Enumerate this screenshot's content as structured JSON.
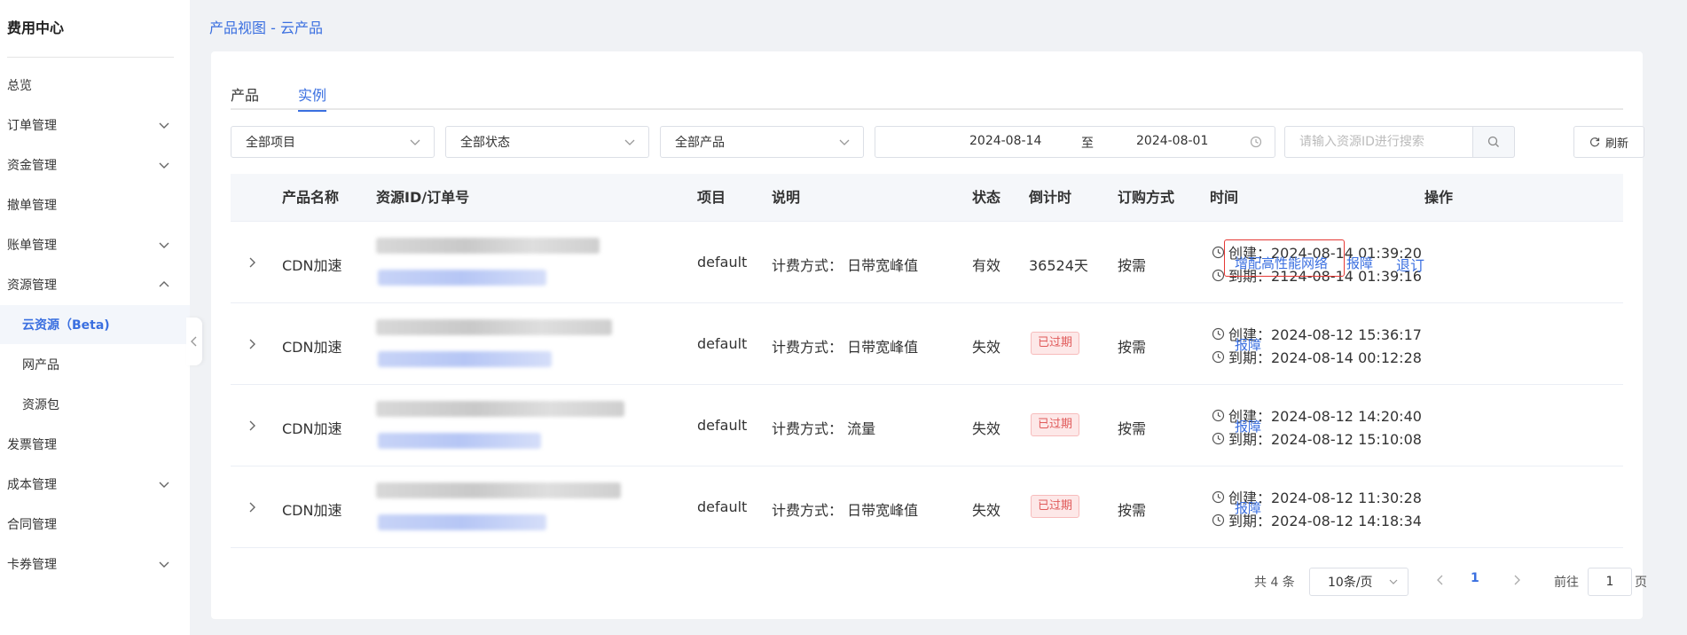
{
  "sidebar": {
    "title": "费用中心",
    "items": [
      {
        "label": "总览"
      },
      {
        "label": "订单管理"
      },
      {
        "label": "资金管理"
      },
      {
        "label": "撤单管理"
      },
      {
        "label": "账单管理"
      },
      {
        "label": "资源管理"
      },
      {
        "label": "云资源（Beta)"
      },
      {
        "label": "网产品"
      },
      {
        "label": "资源包"
      },
      {
        "label": "发票管理"
      },
      {
        "label": "成本管理"
      },
      {
        "label": "合同管理"
      },
      {
        "label": "卡券管理"
      }
    ]
  },
  "breadcrumb": "产品视图 - 云产品",
  "tabs": [
    {
      "label": "产品"
    },
    {
      "label": "实例"
    }
  ],
  "filters": {
    "project": "全部项目",
    "status": "全部状态",
    "product": "全部产品",
    "date_start": "2024-08-14",
    "date_sep": "至",
    "date_end": "2024-08-01",
    "search_placeholder": "请输入资源ID进行搜索",
    "refresh_label": "刷新"
  },
  "table": {
    "headers": {
      "product": "产品名称",
      "resource": "资源ID/订单号",
      "project": "项目",
      "desc": "说明",
      "status": "状态",
      "countdown": "倒计时",
      "billing": "订购方式",
      "time": "时间",
      "actions": "操作"
    },
    "rows": [
      {
        "product": "CDN加速",
        "project": "default",
        "desc": "计费方式： 日带宽峰值",
        "status": "有效",
        "countdown": "36524天",
        "billing": "按需",
        "created": "创建：2024-08-14 01:39:20",
        "expires": "到期：2124-08-14 01:39:16",
        "actions": [
          "增配高性能网络",
          "报障",
          "退订"
        ]
      },
      {
        "product": "CDN加速",
        "project": "default",
        "desc": "计费方式： 日带宽峰值",
        "status": "失效",
        "countdown": "已过期",
        "billing": "按需",
        "created": "创建：2024-08-12 15:36:17",
        "expires": "到期：2024-08-14 00:12:28",
        "actions": [
          "报障"
        ]
      },
      {
        "product": "CDN加速",
        "project": "default",
        "desc": "计费方式： 流量",
        "status": "失效",
        "countdown": "已过期",
        "billing": "按需",
        "created": "创建：2024-08-12 14:20:40",
        "expires": "到期：2024-08-12 15:10:08",
        "actions": [
          "报障"
        ]
      },
      {
        "product": "CDN加速",
        "project": "default",
        "desc": "计费方式： 日带宽峰值",
        "status": "失效",
        "countdown": "已过期",
        "billing": "按需",
        "created": "创建：2024-08-12 11:30:28",
        "expires": "到期：2024-08-12 14:18:34",
        "actions": [
          "报障"
        ]
      }
    ]
  },
  "pagination": {
    "total": "共 4 条",
    "page_size": "10条/页",
    "current_page": "1",
    "goto_label": "前往",
    "goto_value": "1",
    "page_suffix": "页"
  },
  "colors": {
    "accent": "#3a6fe0",
    "expired_badge": "#e05a5a",
    "highlight_border": "#e53935"
  }
}
